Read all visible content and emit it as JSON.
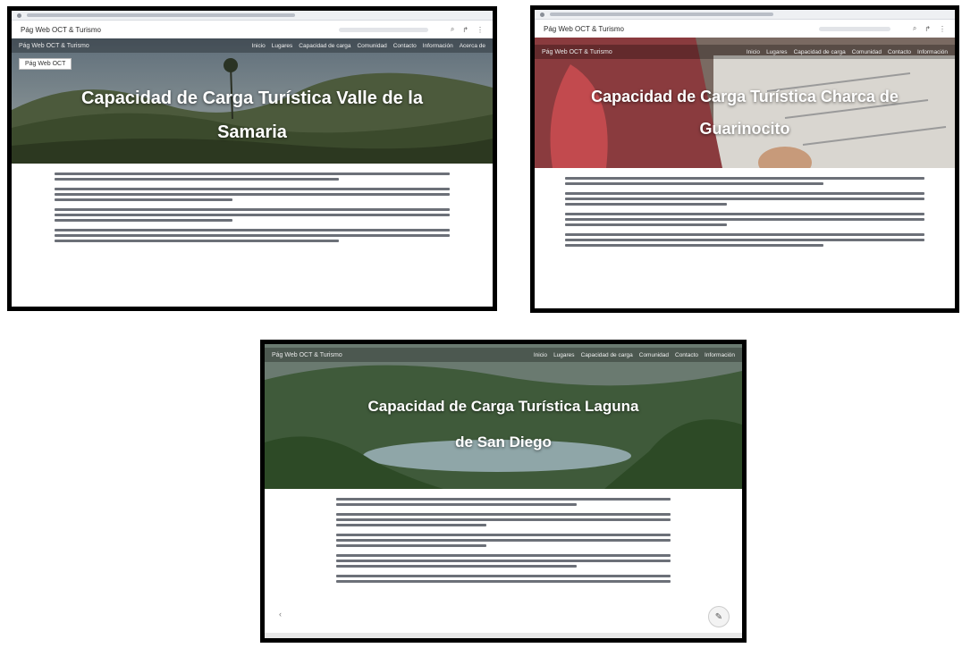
{
  "screenshots": [
    {
      "site_title": "Pág Web OCT & Turismo",
      "hero_title": "Capacidad de Carga Turística Valle de la Samaria",
      "badge": "Pág Web OCT",
      "nav_items": [
        "Inicio",
        "Lugares",
        "Capacidad de carga",
        "Comunidad",
        "Contacto",
        "Información",
        "Acerca de"
      ]
    },
    {
      "site_title": "Pág Web OCT & Turismo",
      "hero_title": "Capacidad de Carga Turística Charca de Guarinocito",
      "nav_items": [
        "Inicio",
        "Lugares",
        "Capacidad de carga",
        "Comunidad",
        "Contacto",
        "Información"
      ]
    },
    {
      "site_title": "Pág Web OCT & Turismo",
      "hero_title": "Capacidad de Carga Turística Laguna de San Diego",
      "nav_items": [
        "Inicio",
        "Lugares",
        "Capacidad de carga",
        "Comunidad",
        "Contacto",
        "Información"
      ]
    }
  ],
  "icons": {
    "search": "⌕",
    "share": "↱",
    "menu": "⋮",
    "edit": "✎",
    "back": "‹"
  }
}
